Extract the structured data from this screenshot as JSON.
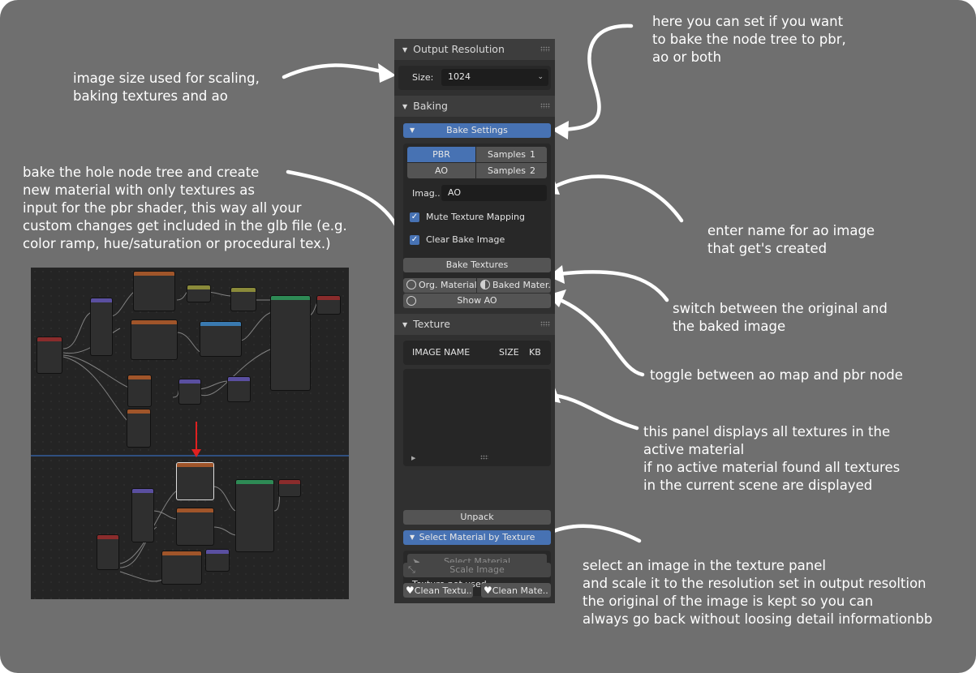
{
  "panel": {
    "output_resolution": {
      "title": "Output Resolution",
      "size_label": "Size:",
      "size_value": "1024"
    },
    "baking": {
      "title": "Baking",
      "bake_settings_label": "Bake Settings",
      "pbr_label": "PBR",
      "ao_label": "AO",
      "samples_label_1": "Samples",
      "samples_value_1": "1",
      "samples_label_2": "Samples",
      "samples_value_2": "2",
      "image_label": "Imag..",
      "image_value": "AO",
      "mute_texture_mapping": "Mute Texture Mapping",
      "clear_bake_image": "Clear Bake Image",
      "bake_textures": "Bake Textures",
      "org_material": "Org. Material",
      "baked_material": "Baked Mater...",
      "show_ao": "Show AO"
    },
    "texture": {
      "title": "Texture",
      "col_image_name": "IMAGE NAME",
      "col_size": "SIZE",
      "col_kb": "KB",
      "unpack": "Unpack",
      "select_material_by_texture": "Select Material by Texture",
      "select_material": "Select Material",
      "texture_not_used": "Texture not used",
      "scale_image": "Scale Image",
      "clean_textures": "Clean Textu..",
      "clean_materials": "Clean Mate.."
    }
  },
  "annotations": {
    "output_resolution": "image size used for scaling,\nbaking textures and ao",
    "bake_mode": "here you can set if you want\nto bake the node tree to pbr,\nao or both",
    "bake_textures": "bake the hole node tree and create\nnew material with only textures as\ninput for the pbr shader, this way all your\ncustom changes get included in the glb file (e.g.\ncolor ramp, hue/saturation or procedural tex.)",
    "ao_name": "enter name for ao image\nthat get's created",
    "switch_material": "switch between the original and\nthe baked image",
    "toggle_ao": "toggle between ao map and pbr node",
    "texture_panel": "this panel displays all textures in the\nactive material\nif no active material found all textures\nin the current scene are displayed",
    "scale_image": "select an image in the texture panel\nand scale it to the resolution set in output resoltion\nthe original of the image is kept so you can\nalways go back without loosing detail informationbb"
  },
  "colors": {
    "background": "#6f6f6f",
    "panel_bg": "#303030",
    "accent_blue": "#4772b3",
    "button_grey": "#545454",
    "arrow_red": "#e02020"
  }
}
